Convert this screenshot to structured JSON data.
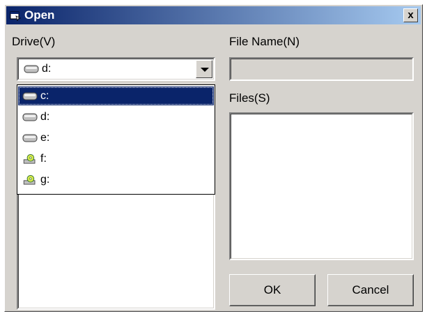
{
  "window": {
    "title": "Open",
    "close_label": "x"
  },
  "drive": {
    "label": "Drive(V)",
    "selected": "d:",
    "options": [
      {
        "label": "c:",
        "icon": "hard-drive-icon",
        "selected": true
      },
      {
        "label": "d:",
        "icon": "hard-drive-icon",
        "selected": false
      },
      {
        "label": "e:",
        "icon": "hard-drive-icon",
        "selected": false
      },
      {
        "label": "f:",
        "icon": "cd-drive-icon",
        "selected": false
      },
      {
        "label": "g:",
        "icon": "cd-drive-icon",
        "selected": false
      }
    ]
  },
  "file_name": {
    "label": "File Name(N)",
    "value": ""
  },
  "files": {
    "label": "Files(S)"
  },
  "buttons": {
    "ok": "OK",
    "cancel": "Cancel"
  },
  "colors": {
    "title_start": "#0a246a",
    "title_end": "#a6caf0",
    "face": "#d6d3ce",
    "highlight": "#0a246a"
  }
}
